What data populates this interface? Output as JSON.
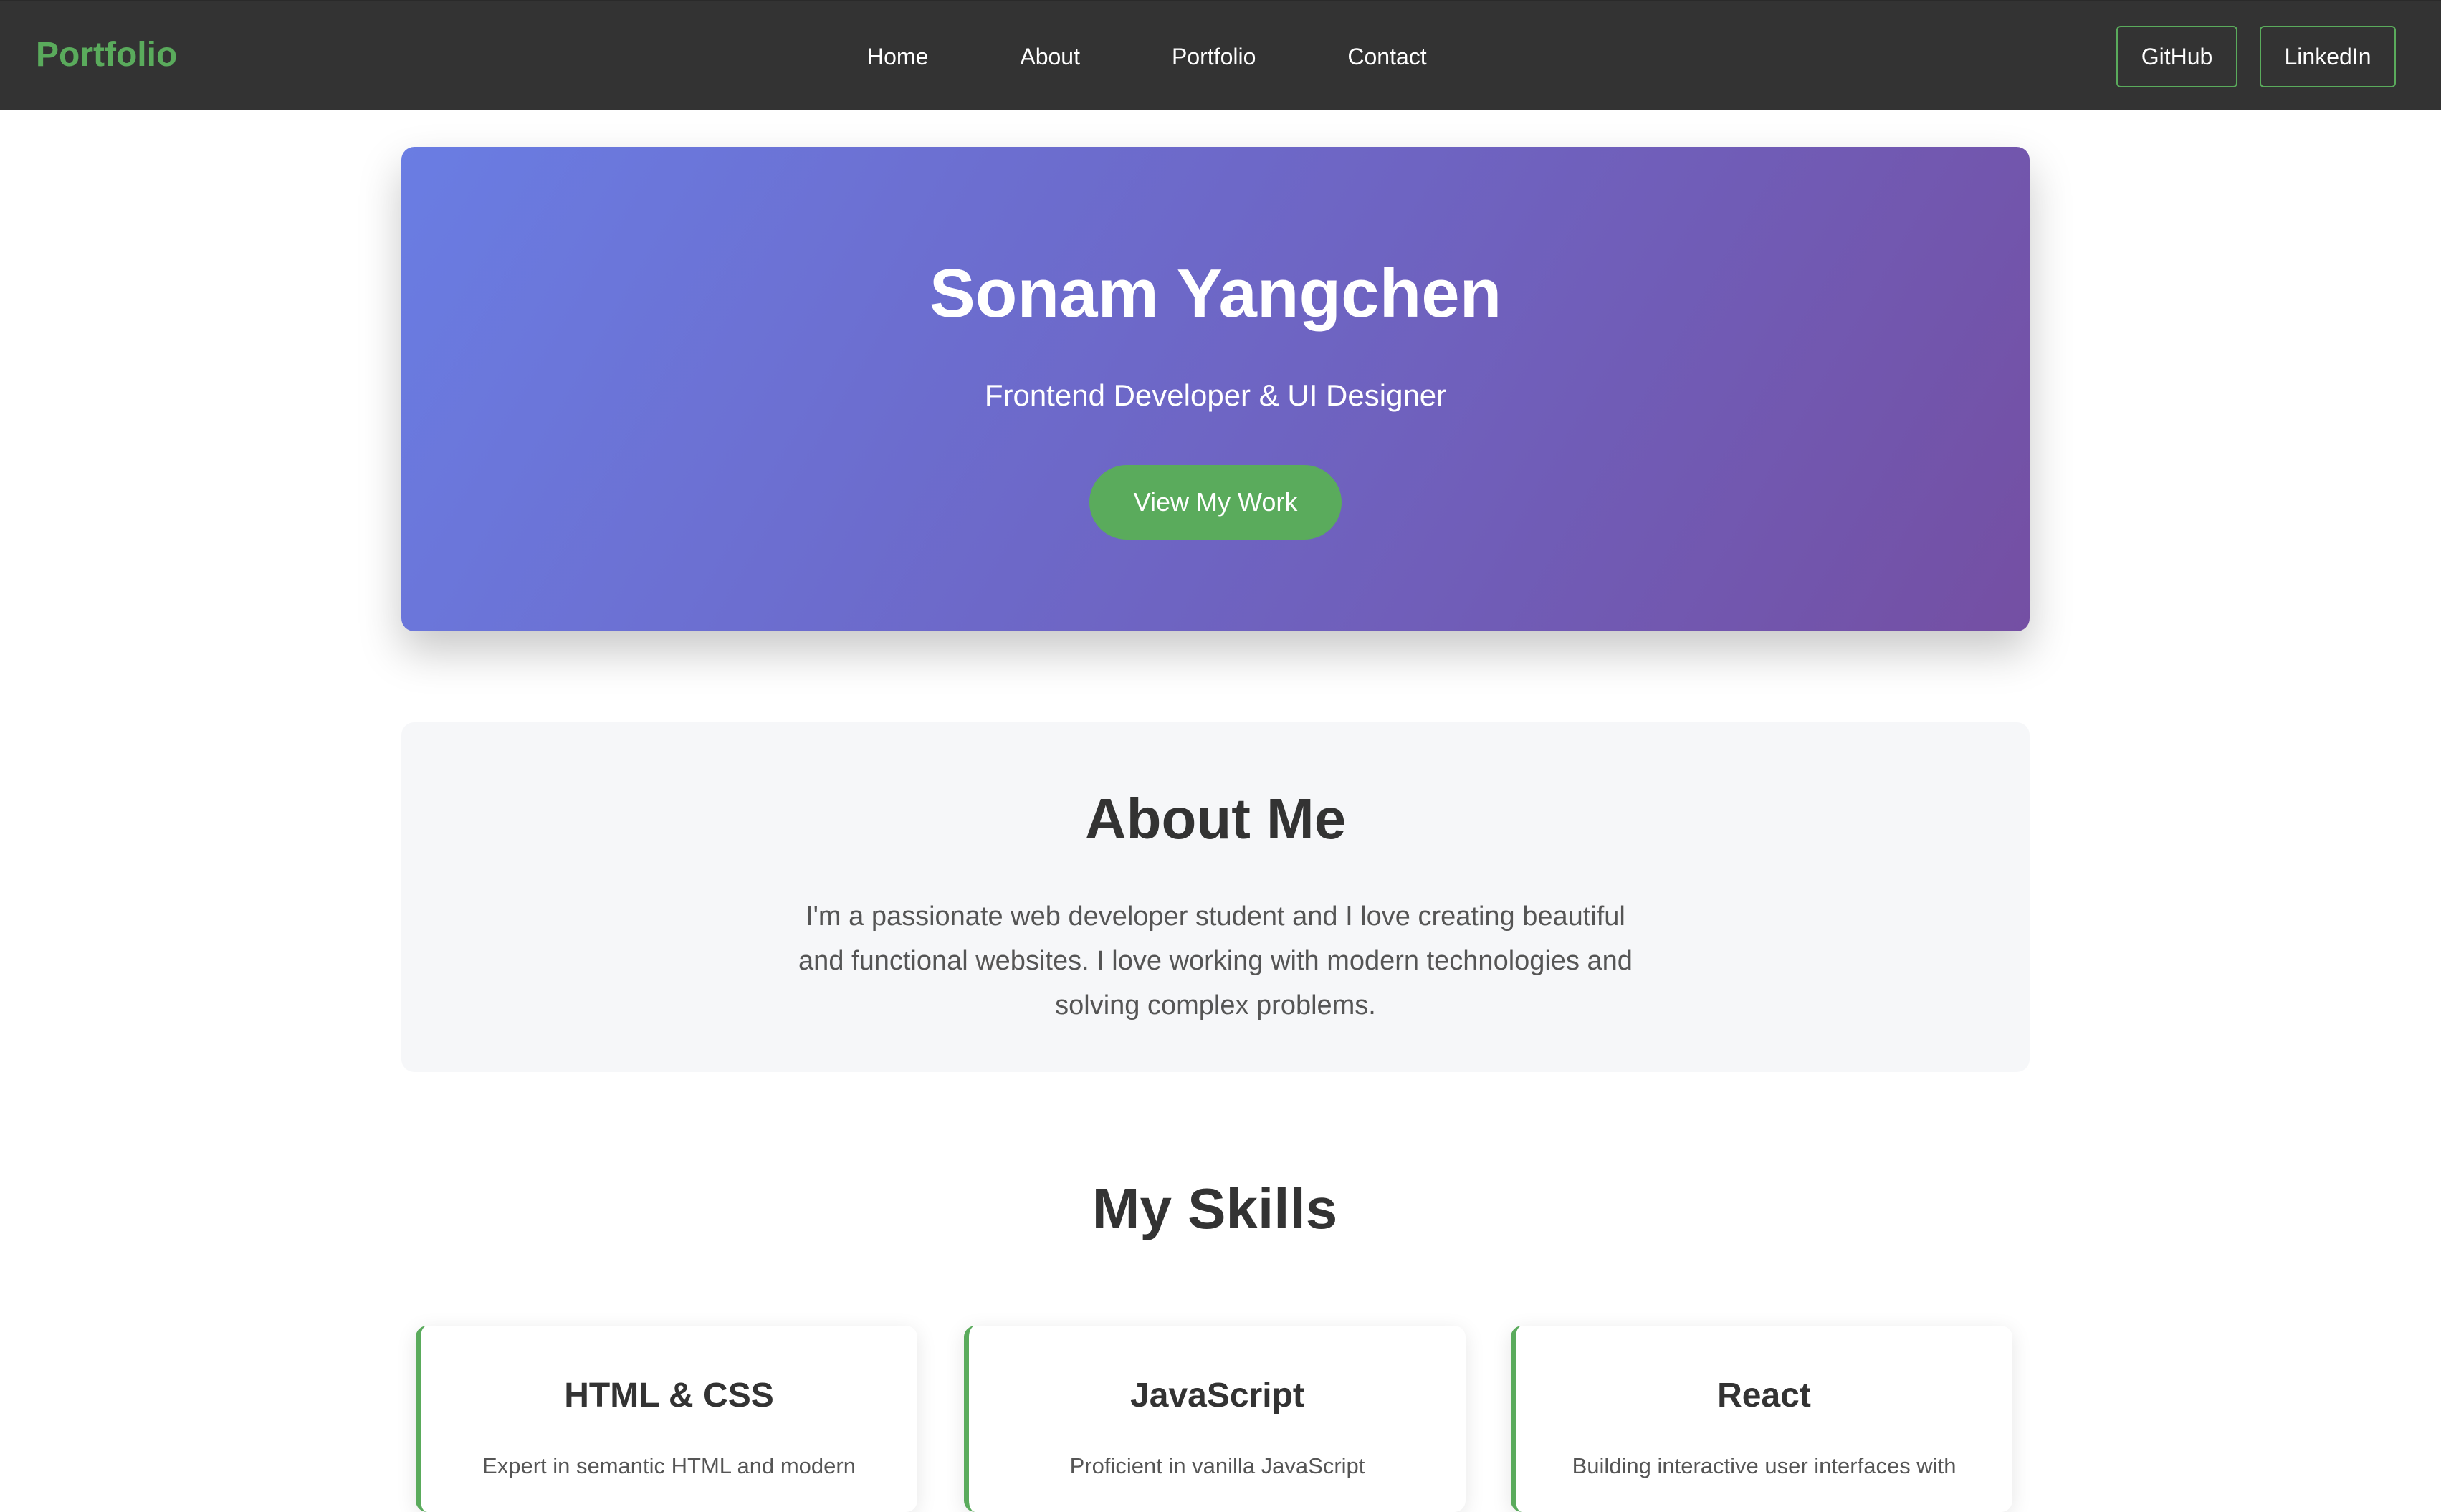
{
  "nav": {
    "brand": "Portfolio",
    "links": [
      "Home",
      "About",
      "Portfolio",
      "Contact"
    ],
    "buttons": {
      "github": "GitHub",
      "linkedin": "LinkedIn"
    }
  },
  "hero": {
    "name": "Sonam Yangchen",
    "tagline": "Frontend Developer & UI Designer",
    "cta": "View My Work"
  },
  "about": {
    "title": "About Me",
    "text": "I'm a passionate web developer student and I love creating beautiful and functional websites. I love working with modern technologies and solving complex problems."
  },
  "skills": {
    "title": "My Skills",
    "cards": [
      {
        "name": "HTML & CSS",
        "desc": "Expert in semantic HTML and modern"
      },
      {
        "name": "JavaScript",
        "desc": "Proficient in vanilla JavaScript"
      },
      {
        "name": "React",
        "desc": "Building interactive user interfaces with"
      }
    ]
  },
  "colors": {
    "accent": "#5aab5c",
    "navbar": "#333333",
    "hero_gradient_start": "#6a7de3",
    "hero_gradient_end": "#744fa3",
    "about_bg": "#f6f7f9"
  }
}
